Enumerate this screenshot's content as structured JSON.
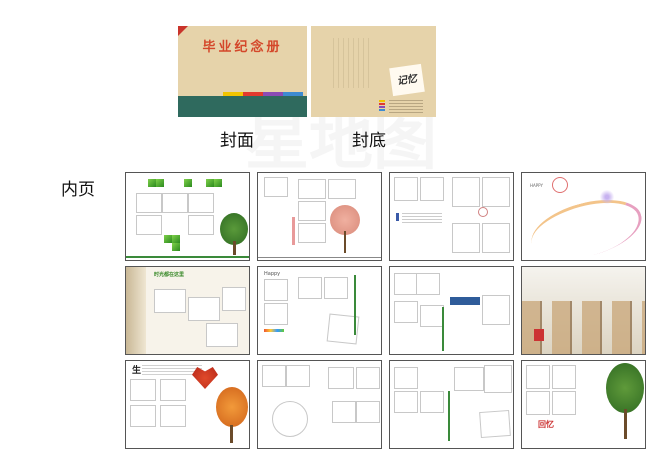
{
  "covers": {
    "front": {
      "title": "毕业纪念册",
      "colorbar": [
        "#f2c400",
        "#e23a2e",
        "#8b4bb5",
        "#3d8bd1"
      ],
      "band_color": "#2f6a5e"
    },
    "front_caption": "封面",
    "back": {
      "stamp_text": "记忆"
    },
    "back_caption": "封底"
  },
  "inner_label": "内页",
  "pages": {
    "p10": {
      "title": "时光都在这里"
    },
    "p13": {
      "title": "回忆"
    },
    "p15": {
      "title": "生"
    },
    "p16": {
      "title": "回忆"
    }
  },
  "colors": {
    "green": "#3d9a2e",
    "pink": "#e8a0a0",
    "red": "#c9342b",
    "paper": "#e6d3aa"
  }
}
